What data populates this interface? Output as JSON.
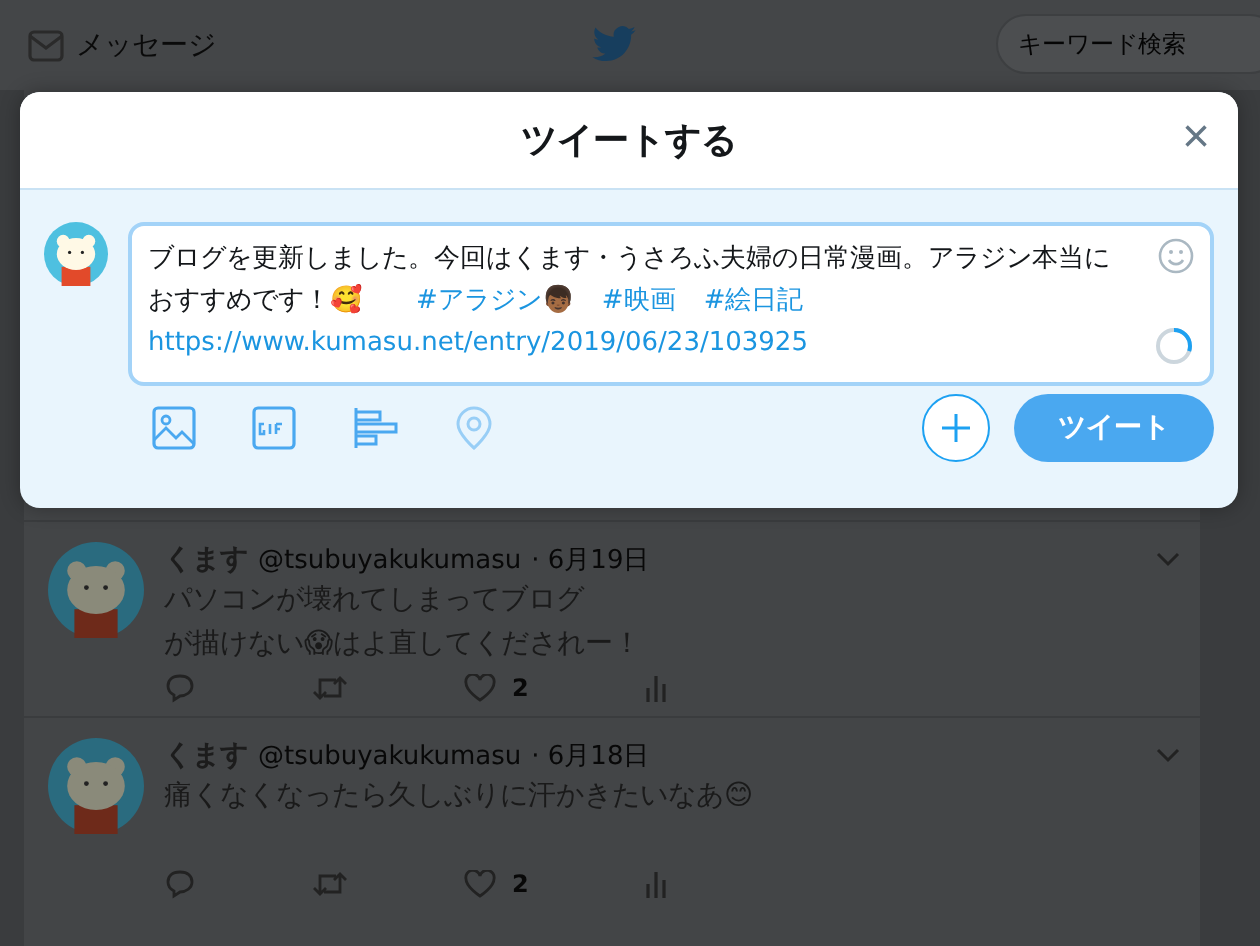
{
  "header": {
    "messages_label": "メッセージ",
    "search": {
      "placeholder": "キーワード検索"
    }
  },
  "modal": {
    "title": "ツイートする",
    "close": "×",
    "composer": {
      "segments": [
        {
          "kind": "text",
          "text": "ブログを更新しました。今回はくます・うさろふ夫婦の日常漫画。アラジン本当におすすめです！🥰　"
        },
        {
          "kind": "hashtag",
          "text": "#アラジン👦🏾"
        },
        {
          "kind": "hashtag",
          "text": "#映画"
        },
        {
          "kind": "hashtag",
          "text": "#絵日記"
        },
        {
          "kind": "link",
          "text": "https://www.kumasu.net/entry/2019/06/23/103925"
        }
      ],
      "progress": {
        "level": 0.3
      }
    },
    "tweet_button": "ツイート"
  },
  "tweets": [
    {
      "name": "くます",
      "handle": "@tsubuyakukumasu",
      "date": "· 6月19日",
      "lines": [
        "パソコンが壊れてしまってブログ",
        "が描けない😱はよ直してくだされー！"
      ],
      "likes": "2"
    },
    {
      "name": "くます",
      "handle": "@tsubuyakukumasu",
      "date": "· 6月18日",
      "lines": [
        "痛くなくなったら久しぶりに汗かきたいなあ😊"
      ],
      "likes": "2"
    }
  ]
}
